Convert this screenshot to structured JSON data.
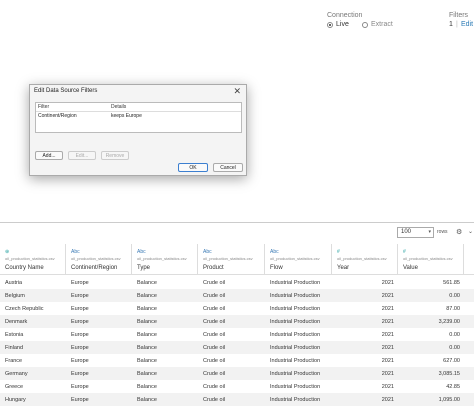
{
  "connection": {
    "label": "Connection",
    "live_label": "Live",
    "extract_label": "Extract"
  },
  "filters": {
    "label": "Filters",
    "count": "1",
    "separator": "|",
    "edit_label": "Edit"
  },
  "dialog": {
    "title": "Edit Data Source Filters",
    "col_filter": "Filter",
    "col_details": "Details",
    "row_filter": "Continent/Region",
    "row_details": "keeps Europe",
    "add_label": "Add...",
    "edit_label": "Edit...",
    "remove_label": "Remove",
    "ok_label": "OK",
    "cancel_label": "Cancel"
  },
  "grid": {
    "rows_value": "100",
    "rows_label": "rows",
    "source": "oil_production_statistics.csv",
    "columns": [
      {
        "type_icon": "⊕",
        "name": "Country Name"
      },
      {
        "type_icon": "Abc",
        "name": "Continent/Region"
      },
      {
        "type_icon": "Abc",
        "name": "Type"
      },
      {
        "type_icon": "Abc",
        "name": "Product"
      },
      {
        "type_icon": "Abc",
        "name": "Flow"
      },
      {
        "type_icon": "#",
        "name": "Year"
      },
      {
        "type_icon": "#",
        "name": "Value"
      }
    ],
    "rows": [
      [
        "Austria",
        "Europe",
        "Balance",
        "Crude oil",
        "Industrial Production",
        "2021",
        "561.85"
      ],
      [
        "Belgium",
        "Europe",
        "Balance",
        "Crude oil",
        "Industrial Production",
        "2021",
        "0.00"
      ],
      [
        "Czech Republic",
        "Europe",
        "Balance",
        "Crude oil",
        "Industrial Production",
        "2021",
        "87.00"
      ],
      [
        "Denmark",
        "Europe",
        "Balance",
        "Crude oil",
        "Industrial Production",
        "2021",
        "3,239.00"
      ],
      [
        "Estonia",
        "Europe",
        "Balance",
        "Crude oil",
        "Industrial Production",
        "2021",
        "0.00"
      ],
      [
        "Finland",
        "Europe",
        "Balance",
        "Crude oil",
        "Industrial Production",
        "2021",
        "0.00"
      ],
      [
        "France",
        "Europe",
        "Balance",
        "Crude oil",
        "Industrial Production",
        "2021",
        "627.00"
      ],
      [
        "Germany",
        "Europe",
        "Balance",
        "Crude oil",
        "Industrial Production",
        "2021",
        "3,085.15"
      ],
      [
        "Greece",
        "Europe",
        "Balance",
        "Crude oil",
        "Industrial Production",
        "2021",
        "42.85"
      ],
      [
        "Hungary",
        "Europe",
        "Balance",
        "Crude oil",
        "Industrial Production",
        "2021",
        "1,095.00"
      ]
    ]
  }
}
